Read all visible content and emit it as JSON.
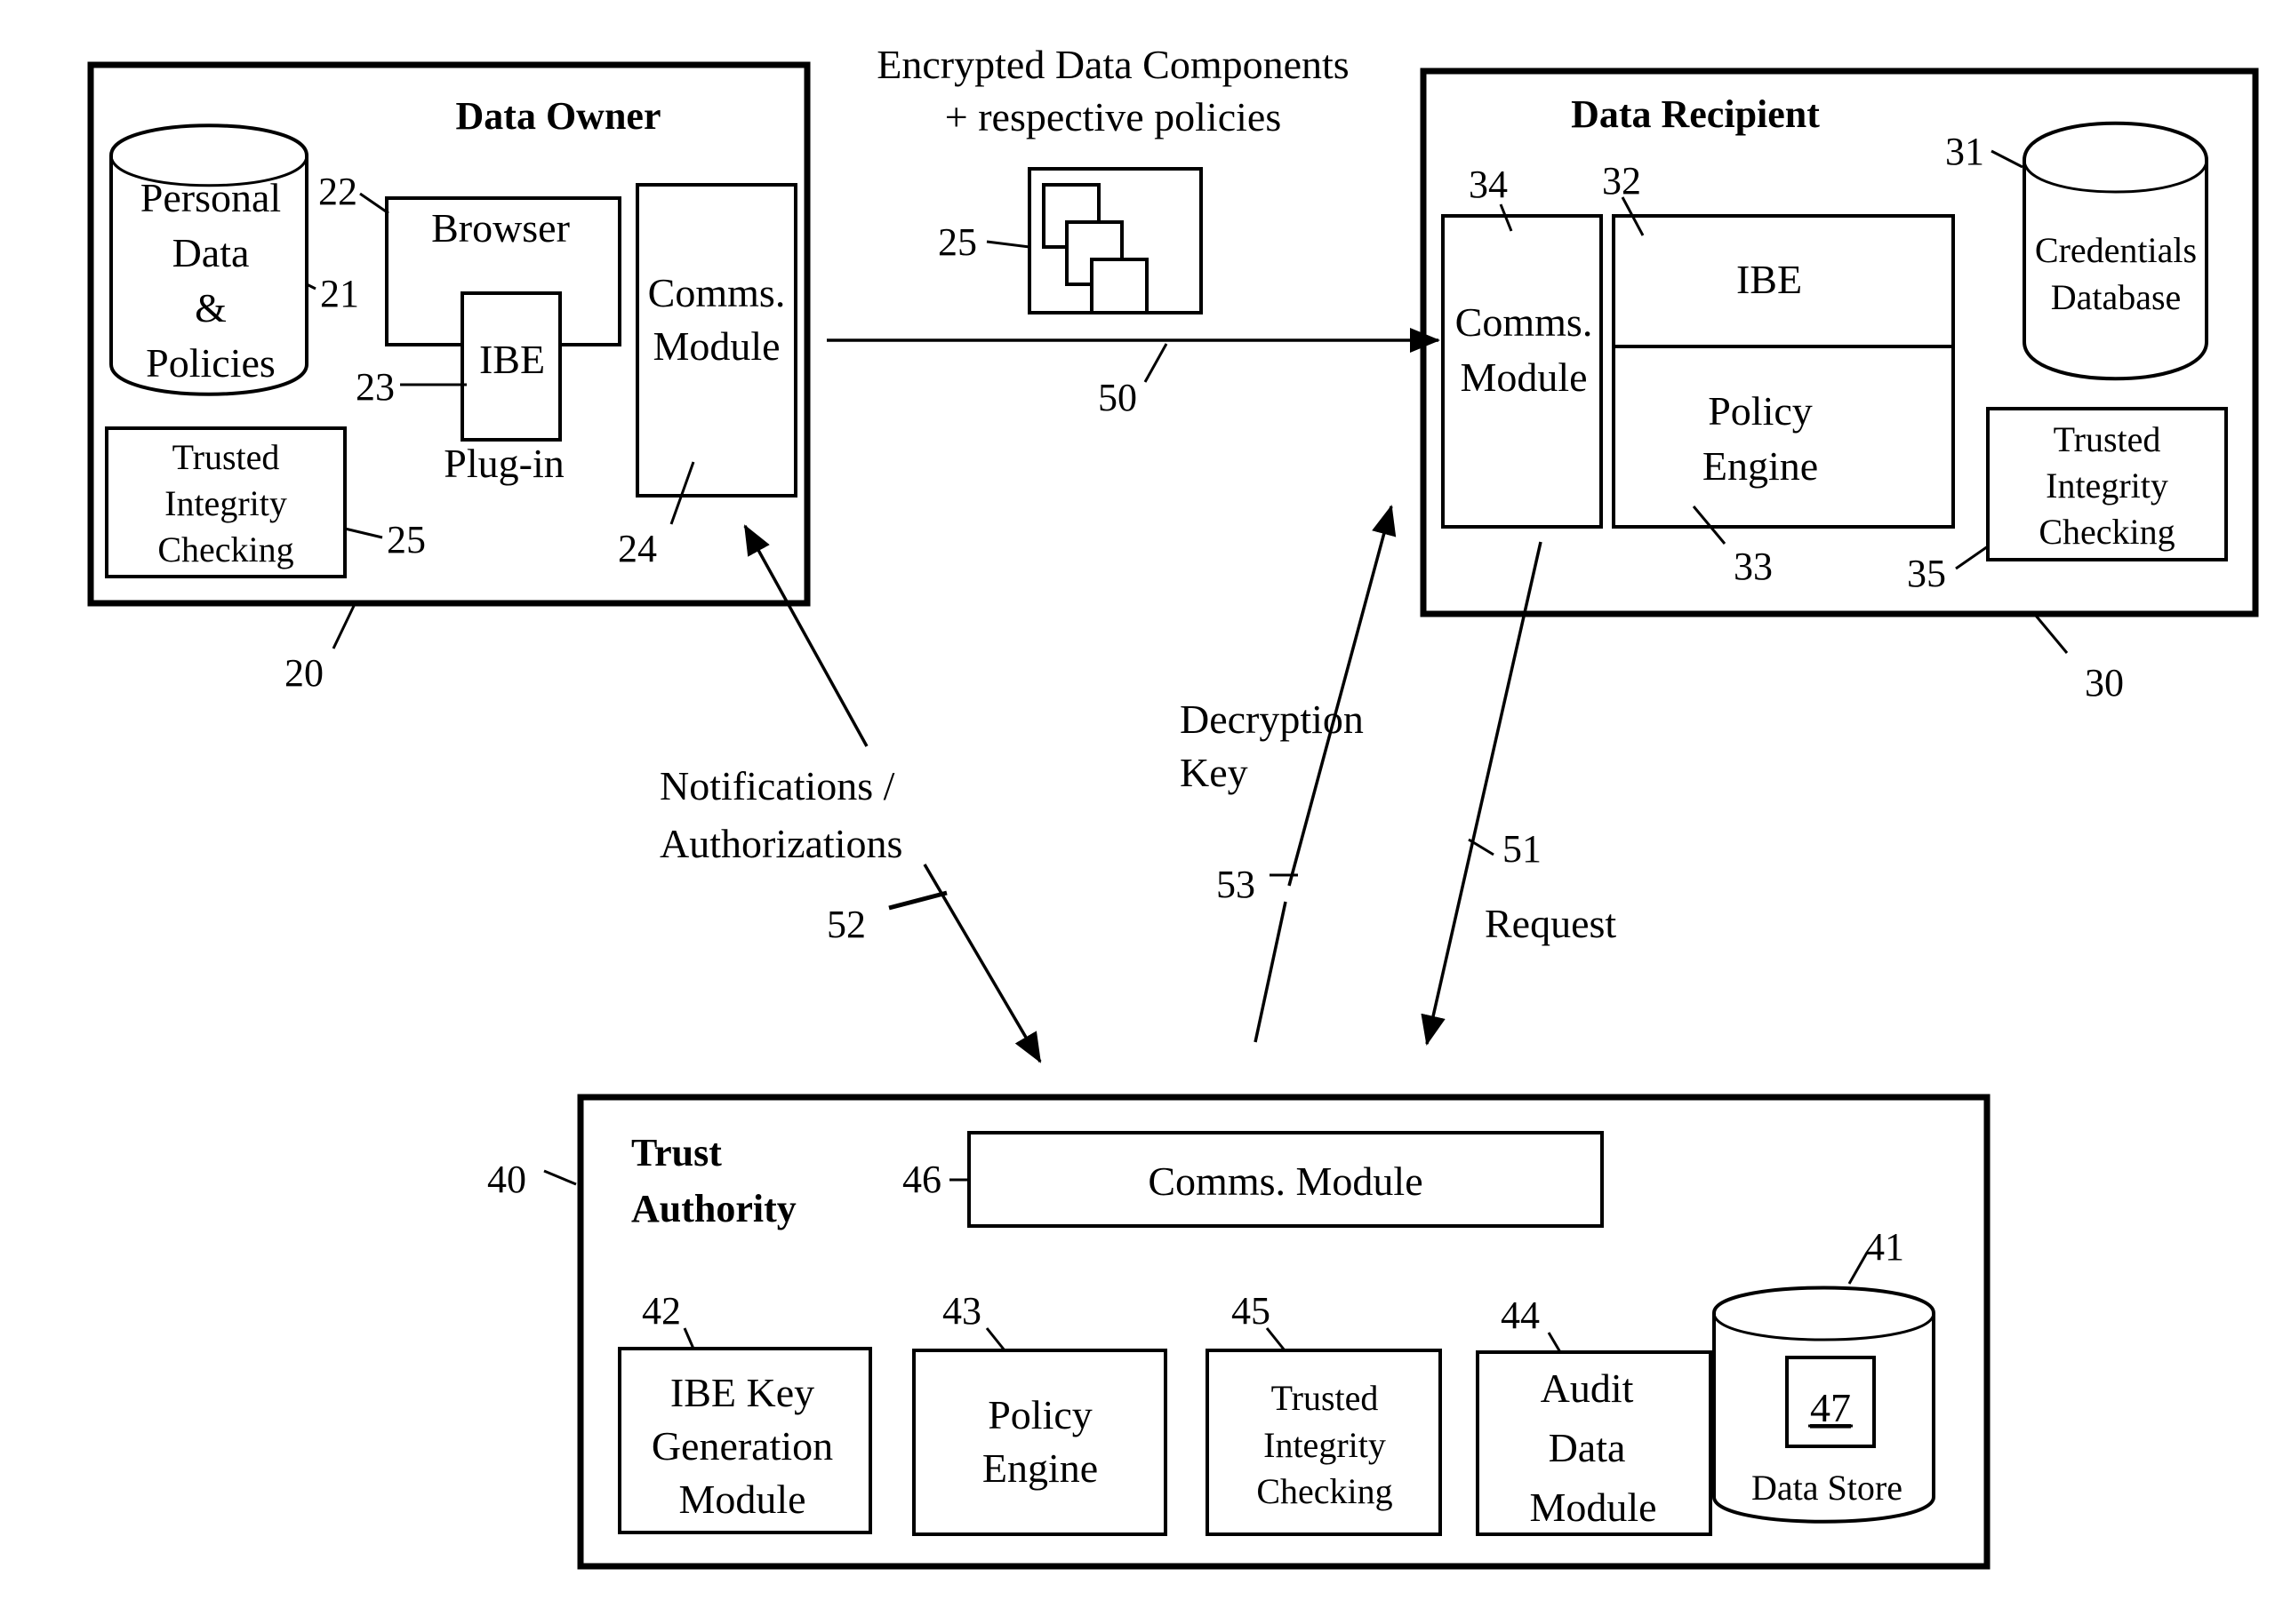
{
  "figure": {
    "data_owner": {
      "title": "Data Owner",
      "ref": "20",
      "database": {
        "lines": [
          "Personal",
          "Data",
          "&",
          "Policies"
        ],
        "ref": "21"
      },
      "browser": {
        "label": "Browser",
        "ref": "22"
      },
      "plugin": {
        "label": "IBE",
        "caption": "Plug-in",
        "ref": "23"
      },
      "comms": {
        "lines": [
          "Comms.",
          "Module"
        ],
        "ref": "24"
      },
      "integrity": {
        "lines": [
          "Trusted",
          "Integrity",
          "Checking"
        ],
        "ref": "25"
      }
    },
    "transfer": {
      "caption_lines": [
        "Encrypted Data Components",
        "+ respective policies"
      ],
      "package_ref": "25",
      "arrow_ref": "50"
    },
    "data_recipient": {
      "title": "Data Recipient",
      "ref": "30",
      "comms": {
        "lines": [
          "Comms.",
          "Module"
        ],
        "ref": "34"
      },
      "ibe": {
        "label": "IBE",
        "ref": "32"
      },
      "policy_engine": {
        "lines": [
          "Policy",
          "Engine"
        ],
        "ref": "33"
      },
      "credentials": {
        "lines": [
          "Credentials",
          "Database"
        ],
        "ref": "31"
      },
      "integrity": {
        "lines": [
          "Trusted",
          "Integrity",
          "Checking"
        ],
        "ref": "35"
      }
    },
    "flows": {
      "notifications": {
        "lines": [
          "Notifications /",
          "Authorizations"
        ],
        "ref": "52"
      },
      "decryption_key": {
        "lines": [
          "Decryption",
          "Key"
        ],
        "ref": "53"
      },
      "request": {
        "label": "Request",
        "ref": "51"
      }
    },
    "trust_authority": {
      "title_lines": [
        "Trust",
        "Authority"
      ],
      "ref": "40",
      "comms": {
        "label": "Comms.  Module",
        "ref": "46"
      },
      "key_gen": {
        "lines": [
          "IBE Key",
          "Generation",
          "Module"
        ],
        "ref": "42"
      },
      "policy_engine": {
        "lines": [
          "Policy",
          "Engine"
        ],
        "ref": "43"
      },
      "integrity": {
        "lines": [
          "Trusted",
          "Integrity",
          "Checking"
        ],
        "ref": "45"
      },
      "audit": {
        "lines": [
          "Audit",
          "Data",
          "Module"
        ],
        "ref": "44"
      },
      "data_store": {
        "label": "Data Store",
        "inner_ref": "47",
        "ref": "41"
      }
    }
  }
}
